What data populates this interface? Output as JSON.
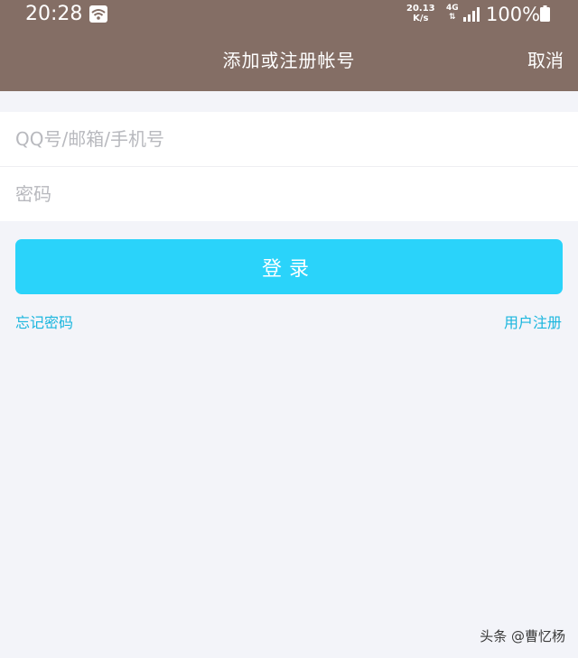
{
  "status_bar": {
    "time": "20:28",
    "speed_value": "20.13",
    "speed_unit": "K/s",
    "network": "4G",
    "battery": "100%"
  },
  "header": {
    "title": "添加或注册帐号",
    "cancel_label": "取消"
  },
  "form": {
    "account_placeholder": "QQ号/邮箱/手机号",
    "account_value": "",
    "password_placeholder": "密码",
    "password_value": "",
    "login_label": "登录"
  },
  "links": {
    "forgot_password": "忘记密码",
    "register": "用户注册"
  },
  "watermark": "头条 @曹忆杨",
  "colors": {
    "header_bg": "#846e65",
    "accent": "#2ad3fa",
    "link": "#1ab6de",
    "page_bg": "#f3f4f9"
  }
}
